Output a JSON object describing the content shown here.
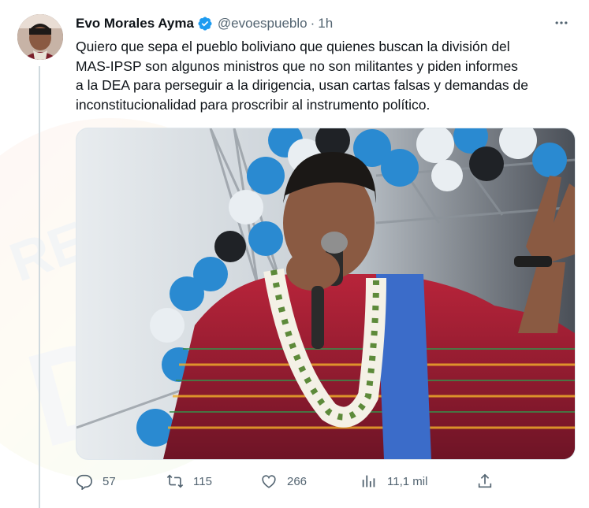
{
  "author": {
    "name": "Evo Morales Ayma",
    "handle": "@evoespueblo",
    "separator": "·",
    "time": "1h"
  },
  "tweet": {
    "lines": [
      "Quiero que sepa el pueblo boliviano que quienes buscan la división del",
      "MAS-IPSP son algunos ministros que no son militantes y piden informes",
      "a la DEA para perseguir a la dirigencia, usan cartas falsas y demandas de",
      "inconstitucionalidad para proscribir al instrumento político."
    ]
  },
  "watermark": {
    "text": "RED",
    "letters": "DTV"
  },
  "actions": {
    "replies": "57",
    "retweets": "115",
    "likes": "266",
    "views": "11,1 mil"
  },
  "colors": {
    "verified": "#1d9bf0",
    "secondary_text": "#536471"
  },
  "icons": [
    "verified-badge-icon",
    "more-options-icon",
    "reply-icon",
    "retweet-icon",
    "like-icon",
    "views-icon",
    "share-icon"
  ]
}
